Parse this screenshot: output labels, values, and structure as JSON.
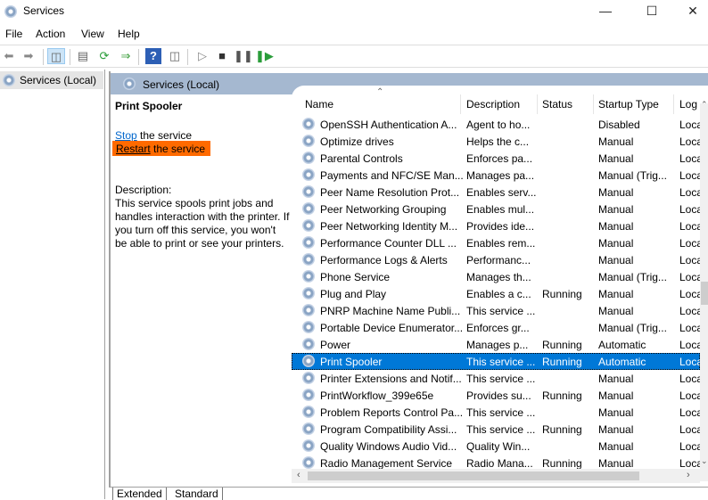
{
  "window": {
    "title": "Services",
    "icon": "services-gear-icon",
    "controls": [
      "minimize",
      "maximize",
      "close"
    ]
  },
  "menu": [
    "File",
    "Action",
    "View",
    "Help"
  ],
  "toolbar": [
    "back",
    "forward",
    "show-hide-console-tree",
    "properties",
    "refresh",
    "export-list",
    "help",
    "show-hide-action-pane",
    "start",
    "stop",
    "pause",
    "resume"
  ],
  "tree": {
    "root": "Services (Local)"
  },
  "pane_header": "Services (Local)",
  "detail": {
    "service_name": "Print Spooler",
    "stop_link": "Stop",
    "stop_rest": " the service",
    "restart_link": "Restart",
    "restart_rest": " the service",
    "restart_highlight": "#ff6a00",
    "description_label": "Description:",
    "description": "This service spools print jobs and handles interaction with the printer. If you turn off this service, you won't be able to print or see your printers."
  },
  "columns": [
    "Name",
    "Description",
    "Status",
    "Startup Type",
    "Log"
  ],
  "sort": {
    "column": "Name",
    "direction": "ascending"
  },
  "rows": [
    [
      "OpenSSH Authentication A...",
      "Agent to ho...",
      "",
      "Disabled",
      "Loca"
    ],
    [
      "Optimize drives",
      "Helps the c...",
      "",
      "Manual",
      "Loca"
    ],
    [
      "Parental Controls",
      "Enforces pa...",
      "",
      "Manual",
      "Loca"
    ],
    [
      "Payments and NFC/SE Man...",
      "Manages pa...",
      "",
      "Manual (Trig...",
      "Loca"
    ],
    [
      "Peer Name Resolution Prot...",
      "Enables serv...",
      "",
      "Manual",
      "Loca"
    ],
    [
      "Peer Networking Grouping",
      "Enables mul...",
      "",
      "Manual",
      "Loca"
    ],
    [
      "Peer Networking Identity M...",
      "Provides ide...",
      "",
      "Manual",
      "Loca"
    ],
    [
      "Performance Counter DLL ...",
      "Enables rem...",
      "",
      "Manual",
      "Loca"
    ],
    [
      "Performance Logs & Alerts",
      "Performanc...",
      "",
      "Manual",
      "Loca"
    ],
    [
      "Phone Service",
      "Manages th...",
      "",
      "Manual (Trig...",
      "Loca"
    ],
    [
      "Plug and Play",
      "Enables a c...",
      "Running",
      "Manual",
      "Loca"
    ],
    [
      "PNRP Machine Name Publi...",
      "This service ...",
      "",
      "Manual",
      "Loca"
    ],
    [
      "Portable Device Enumerator...",
      "Enforces gr...",
      "",
      "Manual (Trig...",
      "Loca"
    ],
    [
      "Power",
      "Manages p...",
      "Running",
      "Automatic",
      "Loca"
    ],
    [
      "Print Spooler",
      "This service ...",
      "Running",
      "Automatic",
      "Loca"
    ],
    [
      "Printer Extensions and Notif...",
      "This service ...",
      "",
      "Manual",
      "Loca"
    ],
    [
      "PrintWorkflow_399e65e",
      "Provides su...",
      "Running",
      "Manual",
      "Loca"
    ],
    [
      "Problem Reports Control Pa...",
      "This service ...",
      "",
      "Manual",
      "Loca"
    ],
    [
      "Program Compatibility Assi...",
      "This service ...",
      "Running",
      "Manual",
      "Loca"
    ],
    [
      "Quality Windows Audio Vid...",
      "Quality Win...",
      "",
      "Manual",
      "Loca"
    ],
    [
      "Radio Management Service",
      "Radio Mana...",
      "Running",
      "Manual",
      "Loca"
    ]
  ],
  "selected_row": "Print Spooler",
  "selection_color": "#0078d7",
  "tabs": [
    "Extended",
    "Standard"
  ],
  "active_tab": "Extended"
}
